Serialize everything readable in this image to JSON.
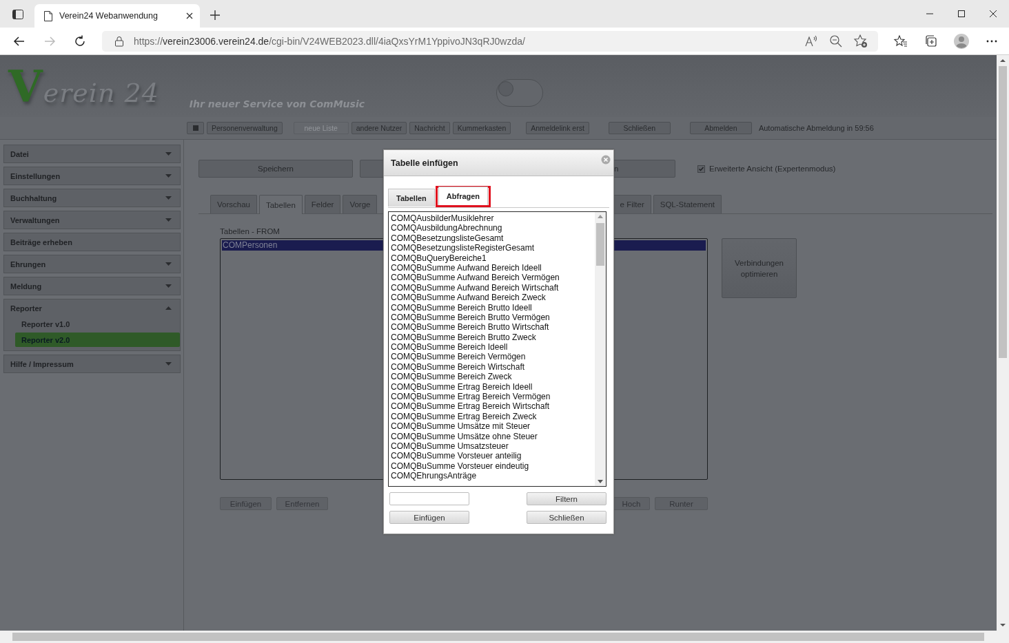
{
  "browser": {
    "tab_title": "Verein24 Webanwendung",
    "url_host": "verein23006.verein24.de",
    "url_rest": "/cgi-bin/V24WEB2023.dll/4iaQxsYrM1YppivoJN3qRJ0wzda/",
    "url_scheme": "https://"
  },
  "header": {
    "logo": "Verein 24",
    "tagline": "Ihr neuer Service von ComMusic",
    "switch": {
      "on": false
    }
  },
  "toolbar": {
    "buttons": [
      {
        "label": "Personenverwaltung",
        "disabled": false
      },
      {
        "label": "neue Liste",
        "disabled": true
      },
      {
        "label": "andere Nutzer",
        "disabled": false
      },
      {
        "label": "Nachricht",
        "disabled": false
      },
      {
        "label": "Kummerkasten",
        "disabled": false
      },
      {
        "label": "Anmeldelink erst",
        "disabled": false
      },
      {
        "label": "Schließen",
        "disabled": false
      },
      {
        "label": "Abmelden",
        "disabled": false
      }
    ],
    "status": "Automatische Abmeldung in 59:56"
  },
  "sidebar": {
    "items": [
      {
        "label": "Datei",
        "kind": "group",
        "expanded": false
      },
      {
        "label": "Einstellungen",
        "kind": "group",
        "expanded": false
      },
      {
        "label": "Buchhaltung",
        "kind": "group",
        "expanded": false
      },
      {
        "label": "Verwaltungen",
        "kind": "group",
        "expanded": false
      },
      {
        "label": "Beiträge erheben",
        "kind": "link",
        "expanded": false
      },
      {
        "label": "Ehrungen",
        "kind": "group",
        "expanded": false
      },
      {
        "label": "Meldung",
        "kind": "group",
        "expanded": false
      },
      {
        "label": "Reporter",
        "kind": "group",
        "expanded": true,
        "children": [
          {
            "label": "Reporter v1.0",
            "selected": false
          },
          {
            "label": "Reporter v2.0",
            "selected": true
          }
        ]
      },
      {
        "label": "Hilfe / Impressum",
        "kind": "group",
        "expanded": false
      }
    ]
  },
  "main": {
    "actions": [
      "Speichern",
      "n"
    ],
    "expert_mode": {
      "label": "Erweiterte Ansicht (Expertenmodus)",
      "checked": true
    },
    "tabs": [
      {
        "label": "Vorschau",
        "selected": false
      },
      {
        "label": "Tabellen",
        "selected": true
      },
      {
        "label": "Felder",
        "selected": false
      },
      {
        "label": "Vorge",
        "selected": false
      },
      {
        "label": "e Filter",
        "selected": false
      },
      {
        "label": "SQL-Statement",
        "selected": false
      }
    ],
    "from_label": "Tabellen - FROM",
    "from_items": [
      {
        "label": "COMPersonen",
        "selected": true
      }
    ],
    "optimize_button": "Verbindungen optimieren",
    "bottom_buttons": [
      "Einfügen",
      "Entfernen",
      "Hoch",
      "Runter"
    ]
  },
  "dialog": {
    "title": "Tabelle einfügen",
    "tabs": [
      {
        "label": "Tabellen",
        "selected": false
      },
      {
        "label": "Abfragen",
        "selected": true
      }
    ],
    "items": [
      "COMQAusbilderMusiklehrer",
      "COMQAusbildungAbrechnung",
      "COMQBesetzungslisteGesamt",
      "COMQBesetzungslisteRegisterGesamt",
      "COMQBuQueryBereiche1",
      "COMQBuSumme Aufwand Bereich Ideell",
      "COMQBuSumme Aufwand Bereich Vermögen",
      "COMQBuSumme Aufwand Bereich Wirtschaft",
      "COMQBuSumme Aufwand Bereich Zweck",
      "COMQBuSumme Bereich Brutto Ideell",
      "COMQBuSumme Bereich Brutto Vermögen",
      "COMQBuSumme Bereich Brutto Wirtschaft",
      "COMQBuSumme Bereich Brutto Zweck",
      "COMQBuSumme Bereich Ideell",
      "COMQBuSumme Bereich Vermögen",
      "COMQBuSumme Bereich Wirtschaft",
      "COMQBuSumme Bereich Zweck",
      "COMQBuSumme Ertrag Bereich Ideell",
      "COMQBuSumme Ertrag Bereich Vermögen",
      "COMQBuSumme Ertrag Bereich Wirtschaft",
      "COMQBuSumme Ertrag Bereich Zweck",
      "COMQBuSumme Umsätze mit Steuer",
      "COMQBuSumme Umsätze ohne Steuer",
      "COMQBuSumme Umsatzsteuer",
      "COMQBuSumme Vorsteuer anteilig",
      "COMQBuSumme Vorsteuer eindeutig",
      "COMQEhrungsAnträge"
    ],
    "filter_button": "Filtern",
    "insert_button": "Einfügen",
    "close_button": "Schließen"
  }
}
